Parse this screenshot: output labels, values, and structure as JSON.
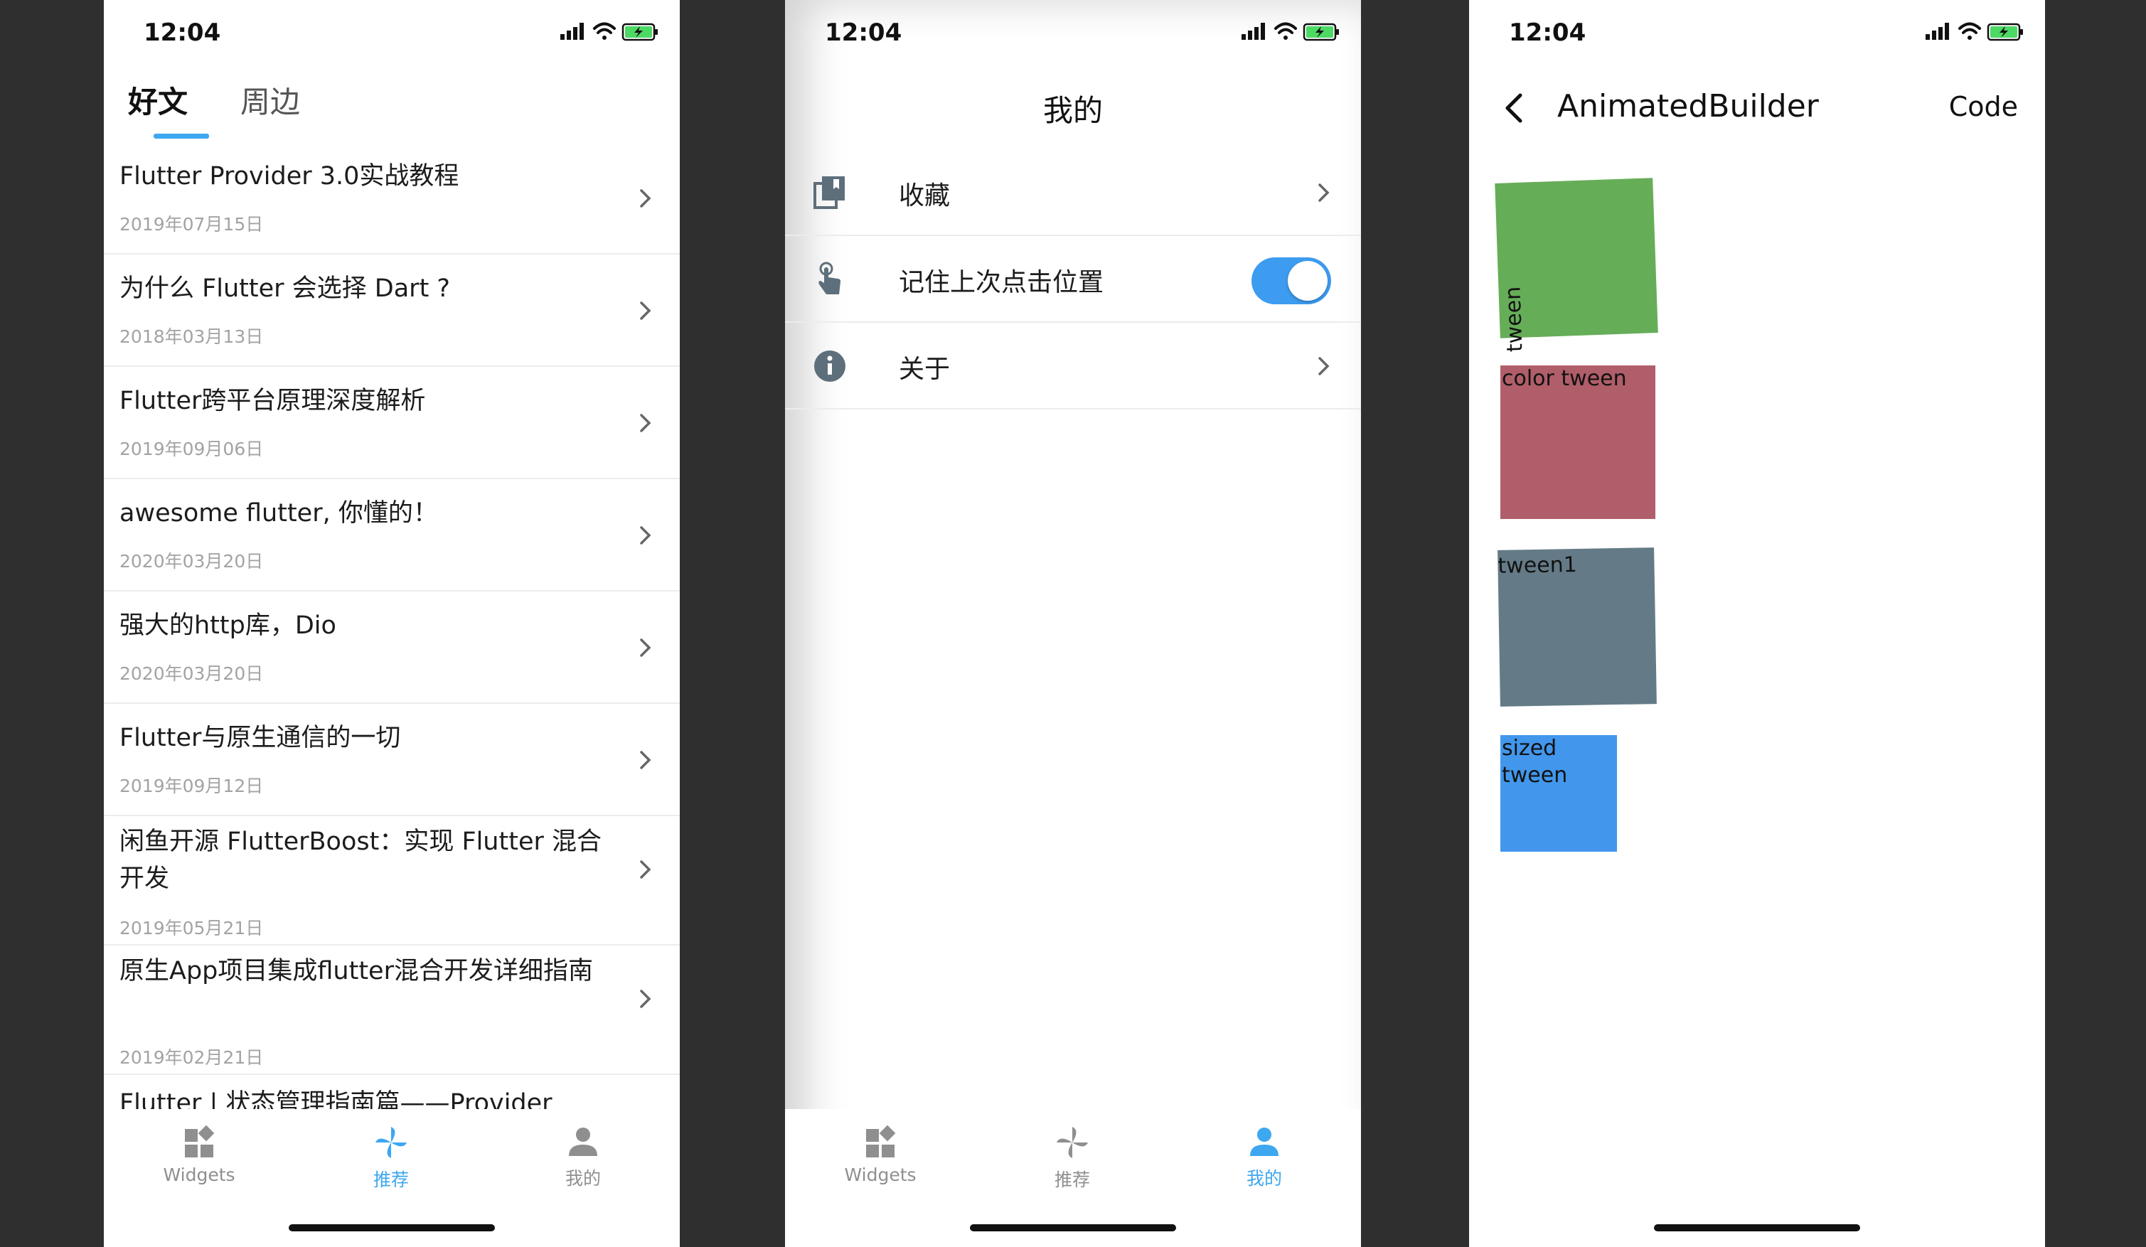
{
  "status": {
    "time": "12:04"
  },
  "page1": {
    "tabs": [
      "好文",
      "周边"
    ],
    "articles": [
      {
        "title": "Flutter Provider 3.0实战教程",
        "date": "2019年07月15日"
      },
      {
        "title": "为什么 Flutter 会选择 Dart ?",
        "date": "2018年03月13日"
      },
      {
        "title": "Flutter跨平台原理深度解析",
        "date": "2019年09月06日"
      },
      {
        "title": "awesome flutter, 你懂的！",
        "date": "2020年03月20日"
      },
      {
        "title": "强大的http库，Dio",
        "date": "2020年03月20日"
      },
      {
        "title": "Flutter与原生通信的一切",
        "date": "2019年09月12日"
      },
      {
        "title": "闲鱼开源 FlutterBoost：实现 Flutter 混合开发",
        "date": "2019年05月21日"
      },
      {
        "title": "原生App项目集成flutter混合开发详细指南",
        "date": "2019年02月21日"
      },
      {
        "title": "Flutter | 状态管理指南篇——Provider",
        "date": ""
      }
    ]
  },
  "nav": {
    "widgets": "Widgets",
    "recommend": "推荐",
    "mine": "我的"
  },
  "page2": {
    "title": "我的",
    "rows": [
      {
        "label": "收藏",
        "icon": "collections-icon"
      },
      {
        "label": "记住上次点击位置",
        "icon": "touch-icon",
        "toggle": true
      },
      {
        "label": "关于",
        "icon": "info-icon"
      }
    ]
  },
  "page3": {
    "title": "AnimatedBuilder",
    "action": "Code",
    "boxes": [
      {
        "label": "tween",
        "color": "#66ad58"
      },
      {
        "label": "color tween",
        "color": "#b05e69"
      },
      {
        "label": "tween1",
        "color": "#647b87"
      },
      {
        "label": "sized tween",
        "color": "#4297ec"
      }
    ]
  },
  "colors": {
    "accent": "#3da7f0",
    "inactive": "#8f8f8f",
    "background": "#2f2f2f"
  }
}
